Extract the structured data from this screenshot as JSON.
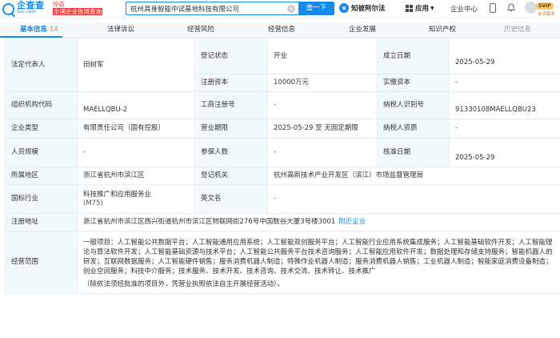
{
  "header": {
    "logo_title": "企查查",
    "logo_sub": "Qcc.com",
    "slogan_line1": "传奇",
    "slogan_line2": "全国企业信用查询",
    "search_value": "杭州具身智能中试基地科技有限公司",
    "search_clear": "×",
    "search_button": "查一下",
    "zhiche_label": "知彼阿尔法",
    "apps_label": "应用",
    "center_label": "企业中心",
    "svip_badge": "SVIP",
    "svip_sub": "会员服务"
  },
  "tabs": [
    {
      "label": "基本信息",
      "count": "14"
    },
    {
      "label": "法律诉讼"
    },
    {
      "label": "经营风险"
    },
    {
      "label": "经营信息"
    },
    {
      "label": "企业发展"
    },
    {
      "label": "知识产权"
    },
    {
      "label": "历史信息"
    }
  ],
  "info": {
    "legal_rep_label": "法定代表人",
    "legal_rep_value": "田树军",
    "reg_status_label": "登记状态",
    "reg_status_value": "开业",
    "established_label": "成立日期",
    "established_value": "2025-05-29",
    "reg_capital_label": "注册资本",
    "reg_capital_value": "10000万元",
    "paid_capital_label": "实缴资本",
    "paid_capital_value": "-",
    "org_code_label": "组织机构代码",
    "org_code_value": "MAELLQBU-2",
    "bizreg_label": "工商注册号",
    "bizreg_value": "-",
    "taxpayer_id_label": "纳税人识别号",
    "taxpayer_id_value": "91330108MAELLQBU23",
    "type_label": "企业类型",
    "type_value": "有限责任公司（国有控股）",
    "term_label": "营业期限",
    "term_value": "2025-05-29 至 无固定期限",
    "taxpayer_qual_label": "纳税人资质",
    "taxpayer_qual_value": "-",
    "staff_label": "人员规模",
    "staff_value": "-",
    "insured_label": "参保人数",
    "insured_value": "-",
    "approval_label": "核准日期",
    "approval_value": "2025-05-29",
    "region_label": "所属地区",
    "region_value": "浙江省杭州市滨江区",
    "authority_label": "登记机关",
    "authority_value": "杭州高新技术产业开发区（滨江）市场监督管理局",
    "industry_label": "国标行业",
    "industry_value": "科技推广和应用服务业",
    "industry_code": "(M75)",
    "english_label": "英文名",
    "english_value": "-",
    "address_label": "注册地址",
    "address_value": "浙江省杭州市滨江区西兴街道杭州市滨江区物联网街276号中国数谷大厦3号楼3001",
    "address_link": "附近企业",
    "scope_label": "经营范围",
    "scope_value": "一般项目：人工智能公共数据平台；人工智能通用应用系统；人工智能双创服务平台；人工智能行业应用系统集成服务；人工智能基础软件开发；人工智能理论与算法软件开发；人工智能基础资源与技术平台；人工智能公共服务平台技术咨询服务；人工智能应用软件开发；数据处理和存储支持服务；智能机器人的研发；互联网数据服务；人工智能硬件销售；服务消费机器人制造；特殊作业机器人制造；服务消费机器人销售；工业机器人制造；智能家庭消费设备制造；创业空间服务；科技中介服务；技术服务、技术开发、技术咨询、技术交流、技术转让、技术推广",
    "scope_note": "（除依法须经批准的项目外，凭营业执照依法自主开展经营活动）。"
  }
}
